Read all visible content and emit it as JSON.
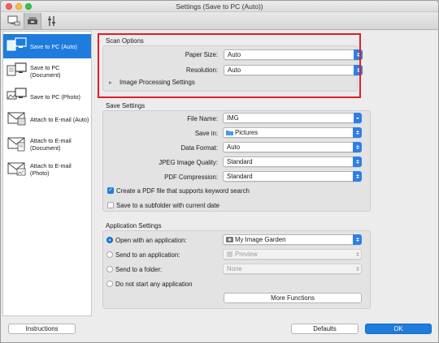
{
  "window": {
    "title": "Settings (Save to PC (Auto))"
  },
  "toolbar": {
    "tabs": [
      "scan-from-computer-icon",
      "scan-from-operation-panel-icon",
      "general-settings-icon"
    ]
  },
  "sidebar": {
    "items": [
      {
        "label": "Save to PC (Auto)",
        "icon": "save-to-pc-icon",
        "selected": true
      },
      {
        "label": "Save to PC (Document)",
        "icon": "save-to-pc-document-icon",
        "selected": false
      },
      {
        "label": "Save to PC (Photo)",
        "icon": "save-to-pc-photo-icon",
        "selected": false
      },
      {
        "label": "Attach to E-mail (Auto)",
        "icon": "email-icon",
        "selected": false
      },
      {
        "label_line1": "Attach to E-mail",
        "label_line2": "(Document)",
        "icon": "email-document-icon",
        "selected": false
      },
      {
        "label": "Attach to E-mail (Photo)",
        "icon": "email-photo-icon",
        "selected": false
      }
    ]
  },
  "scan_options": {
    "title": "Scan Options",
    "paper_size_label": "Paper Size:",
    "paper_size_value": "Auto",
    "resolution_label": "Resolution:",
    "resolution_value": "Auto",
    "image_processing_label": "Image Processing Settings"
  },
  "save_settings": {
    "title": "Save Settings",
    "file_name_label": "File Name:",
    "file_name_value": "IMG",
    "save_in_label": "Save in:",
    "save_in_value": "Pictures",
    "data_format_label": "Data Format:",
    "data_format_value": "Auto",
    "jpeg_quality_label": "JPEG Image Quality:",
    "jpeg_quality_value": "Standard",
    "pdf_compression_label": "PDF Compression:",
    "pdf_compression_value": "Standard",
    "keyword_pdf_label": "Create a PDF file that supports keyword search",
    "keyword_pdf_checked": true,
    "subfolder_label": "Save to a subfolder with current date",
    "subfolder_checked": false
  },
  "app_settings": {
    "title": "Application Settings",
    "open_with_label": "Open with an application:",
    "open_with_value": "My Image Garden",
    "send_to_app_label": "Send to an application:",
    "send_to_app_value": "Preview",
    "send_to_folder_label": "Send to a folder:",
    "send_to_folder_value": "None",
    "do_not_start_label": "Do not start any application",
    "more_functions_label": "More Functions"
  },
  "footer": {
    "instructions_label": "Instructions",
    "defaults_label": "Defaults",
    "ok_label": "OK"
  },
  "colors": {
    "accent": "#1f7bdc",
    "highlight": "#e01f26"
  }
}
